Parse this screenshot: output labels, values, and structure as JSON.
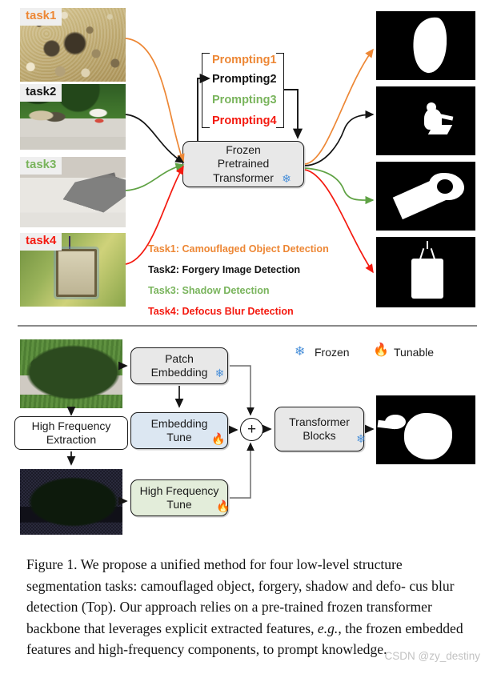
{
  "figure": {
    "number": "Figure 1.",
    "caption_line1": "Figure 1. We propose a unified method for four low-level structure",
    "caption_line2": "segmentation tasks: camouflaged object, forgery, shadow and defo-",
    "caption_line3": "cus blur detection (Top). Our approach relies on a pre-trained frozen",
    "caption_line4a": "transformer backbone that leverages explicit extracted features, ",
    "caption_line4b": "e.g.",
    "caption_line4c": ", ",
    "caption_line5": "the frozen embedded features and high-frequency components, to",
    "caption_line6": "prompt knowledge.",
    "watermark": "CSDN @zy_destiny"
  },
  "colors": {
    "task1": "#ED8735",
    "task2": "#141414",
    "task3": "#79B45C",
    "task4": "#F41A10",
    "box_gray": "#E8E8E8",
    "box_blue": "#DCE7F2",
    "box_green": "#E3EDDA",
    "snowflake": "#4A90D9",
    "flame": "#F07828",
    "divider": "#8A8A8A"
  },
  "top_panel": {
    "inputs": [
      {
        "tag": "task1",
        "color_key": "task1",
        "texture": "gravel"
      },
      {
        "tag": "task2",
        "color_key": "task2",
        "texture": "park"
      },
      {
        "tag": "task3",
        "color_key": "task3",
        "texture": "shadow"
      },
      {
        "tag": "task4",
        "color_key": "task4",
        "texture": "blur"
      }
    ],
    "prompts": [
      {
        "label": "Prompting1",
        "color_key": "task1"
      },
      {
        "label": "Prompting2",
        "color_key": "task2"
      },
      {
        "label": "Prompting3",
        "color_key": "task3"
      },
      {
        "label": "Prompting4",
        "color_key": "task4"
      }
    ],
    "backbone": {
      "line1": "Frozen",
      "line2": "Pretrained",
      "line3": "Transformer",
      "icon": "snowflake-icon"
    },
    "task_legend": [
      {
        "label": "Task1: Camouflaged Object Detection",
        "color_key": "task1"
      },
      {
        "label": "Task2: Forgery Image Detection",
        "color_key": "task2"
      },
      {
        "label": "Task3: Shadow Detection",
        "color_key": "task3"
      },
      {
        "label": "Task4: Defocus Blur Detection",
        "color_key": "task4"
      }
    ],
    "outputs": [
      {
        "name": "camouflage-mask",
        "arrow_color_key": "task1"
      },
      {
        "name": "forgery-mask",
        "arrow_color_key": "task2"
      },
      {
        "name": "shadow-mask",
        "arrow_color_key": "task3"
      },
      {
        "name": "defocus-mask",
        "arrow_color_key": "task4"
      }
    ]
  },
  "bottom_panel": {
    "legend": [
      {
        "icon": "snowflake-icon",
        "label": "Frozen"
      },
      {
        "icon": "flame-icon",
        "label": "Tunable"
      }
    ],
    "boxes": [
      {
        "id": "patch_embedding",
        "line1": "Patch",
        "line2": "Embedding",
        "icon": "snowflake-icon",
        "style": "gray"
      },
      {
        "id": "embedding_tune",
        "line1": "Embedding",
        "line2": "Tune",
        "icon": "flame-icon",
        "style": "blue"
      },
      {
        "id": "high_frequency_tune",
        "line1": "High Frequency",
        "line2": "Tune",
        "icon": "flame-icon",
        "style": "green"
      },
      {
        "id": "high_frequency_extraction",
        "line1": "High Frequency",
        "line2": "Extraction",
        "icon": "",
        "style": "white"
      },
      {
        "id": "transformer_blocks",
        "line1": "Transformer",
        "line2": "Blocks",
        "icon": "snowflake-icon",
        "style": "gray"
      }
    ],
    "sum_node": "+",
    "input_image_name": "shadow-input-image",
    "hf_image_name": "high-frequency-image",
    "output_image_name": "shadow-output-mask"
  }
}
